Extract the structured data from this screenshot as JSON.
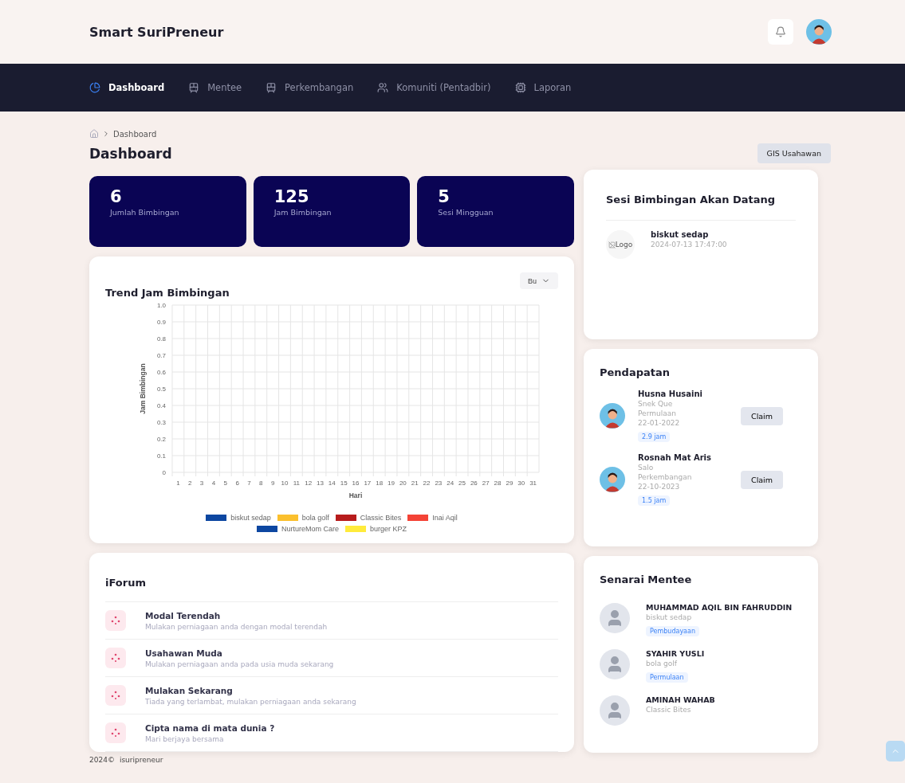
{
  "brand": "Smart SuriPreneur",
  "nav": [
    {
      "label": "Dashboard",
      "selected": true
    },
    {
      "label": "Mentee",
      "selected": false
    },
    {
      "label": "Perkembangan",
      "selected": false
    },
    {
      "label": "Komuniti (Pentadbir)",
      "selected": false
    },
    {
      "label": "Laporan",
      "selected": false
    }
  ],
  "breadcrumb": [
    "Dashboard"
  ],
  "page_title": "Dashboard",
  "gis_button": "GIS Usahawan",
  "stats": [
    {
      "value": "6",
      "label": "Jumlah Bimbingan"
    },
    {
      "value": "125",
      "label": "Jam Bimbingan"
    },
    {
      "value": "5",
      "label": "Sesi Mingguan"
    }
  ],
  "trend": {
    "title": "Trend Jam Bimbingan",
    "period": "Bu",
    "chart_data": {
      "type": "line",
      "xlabel": "Hari",
      "ylabel": "Jam Bimbingan",
      "x": [
        1,
        2,
        3,
        4,
        5,
        6,
        7,
        8,
        9,
        10,
        11,
        12,
        13,
        14,
        15,
        16,
        17,
        18,
        19,
        20,
        21,
        22,
        23,
        24,
        25,
        26,
        27,
        28,
        29,
        30,
        31
      ],
      "ylim": [
        0,
        1
      ],
      "grid": true,
      "yticks": [
        {
          "value": 0,
          "label": "0"
        },
        0.1,
        0.2,
        0.3,
        0.4,
        0.5,
        0.6,
        0.7,
        0.8,
        0.9,
        {
          "value": 1,
          "label": "1.0"
        }
      ],
      "series": [
        {
          "name": "biskut sedap",
          "color": "#0d47a1",
          "values": [
            null,
            null,
            null,
            null,
            null,
            null,
            null,
            null,
            null,
            null,
            null,
            null,
            null,
            null,
            null,
            null,
            null,
            null,
            null,
            null,
            null,
            null,
            null,
            null,
            null,
            null,
            null,
            null,
            null,
            null,
            null
          ]
        },
        {
          "name": "bola golf",
          "color": "#fbc02d",
          "values": [
            null,
            null,
            null,
            null,
            null,
            null,
            null,
            null,
            null,
            null,
            null,
            null,
            null,
            null,
            null,
            null,
            null,
            null,
            null,
            null,
            null,
            null,
            null,
            null,
            null,
            null,
            null,
            null,
            null,
            null,
            null
          ]
        },
        {
          "name": "Classic Bites",
          "color": "#b71c1c",
          "values": [
            null,
            null,
            null,
            null,
            null,
            null,
            null,
            null,
            null,
            null,
            null,
            null,
            null,
            null,
            null,
            null,
            null,
            null,
            null,
            null,
            null,
            null,
            null,
            null,
            null,
            null,
            null,
            null,
            null,
            null,
            null
          ]
        },
        {
          "name": "Inai Aqil",
          "color": "#f44336",
          "values": [
            null,
            null,
            null,
            null,
            null,
            null,
            null,
            null,
            null,
            null,
            null,
            null,
            null,
            null,
            null,
            null,
            null,
            null,
            null,
            null,
            null,
            null,
            null,
            null,
            null,
            null,
            null,
            null,
            null,
            null,
            null
          ]
        },
        {
          "name": "NurtureMom Care",
          "color": "#0d47a1",
          "values": [
            null,
            null,
            null,
            null,
            null,
            null,
            null,
            null,
            null,
            null,
            null,
            null,
            null,
            null,
            null,
            null,
            null,
            null,
            null,
            null,
            null,
            null,
            null,
            null,
            null,
            null,
            null,
            null,
            null,
            null,
            null
          ]
        },
        {
          "name": "burger KPZ",
          "color": "#ffeb3b",
          "values": [
            null,
            null,
            null,
            null,
            null,
            null,
            null,
            null,
            null,
            null,
            null,
            null,
            null,
            null,
            null,
            null,
            null,
            null,
            null,
            null,
            null,
            null,
            null,
            null,
            null,
            null,
            null,
            null,
            null,
            null,
            null
          ]
        }
      ]
    }
  },
  "forum": {
    "title": "iForum",
    "topics": [
      {
        "title": "Modal Terendah",
        "text": "Mulakan perniagaan anda dengan modal terendah"
      },
      {
        "title": "Usahawan Muda",
        "text": "Mulakan perniagaan anda pada usia muda sekarang"
      },
      {
        "title": "Mulakan Sekarang",
        "text": "Tiada yang terlambat, mulakan perniagaan anda sekarang"
      },
      {
        "title": "Cipta nama di mata dunia ?",
        "text": "Mari berjaya bersama"
      }
    ]
  },
  "sessions": {
    "title": "Sesi Bimbingan Akan Datang",
    "items": [
      {
        "logo_alt": "Logo",
        "name": "biskut sedap",
        "time": "2024-07-13 17:47:00"
      }
    ]
  },
  "income": {
    "title": "Pendapatan",
    "items": [
      {
        "name": "Husna Husaini",
        "business": "Snek Que",
        "stage": "Permulaan",
        "date": "22-01-2022",
        "hours": "2.9 jam",
        "button": "Claim"
      },
      {
        "name": "Rosnah Mat Aris",
        "business": "Salo",
        "stage": "Perkembangan",
        "date": "22-10-2023",
        "hours": "1.5 jam",
        "button": "Claim"
      }
    ]
  },
  "mentees": {
    "title": "Senarai Mentee",
    "items": [
      {
        "name": "MUHAMMAD AQIL BIN FAHRUDDIN",
        "business": "biskut sedap",
        "stage": "Pembudayaan"
      },
      {
        "name": "SYAHIR YUSLI",
        "business": "bola golf",
        "stage": "Permulaan"
      },
      {
        "name": "AMINAH WAHAB",
        "business": "Classic Bites"
      }
    ]
  },
  "footer": {
    "year": "2024©",
    "name": "isuripreneur"
  }
}
